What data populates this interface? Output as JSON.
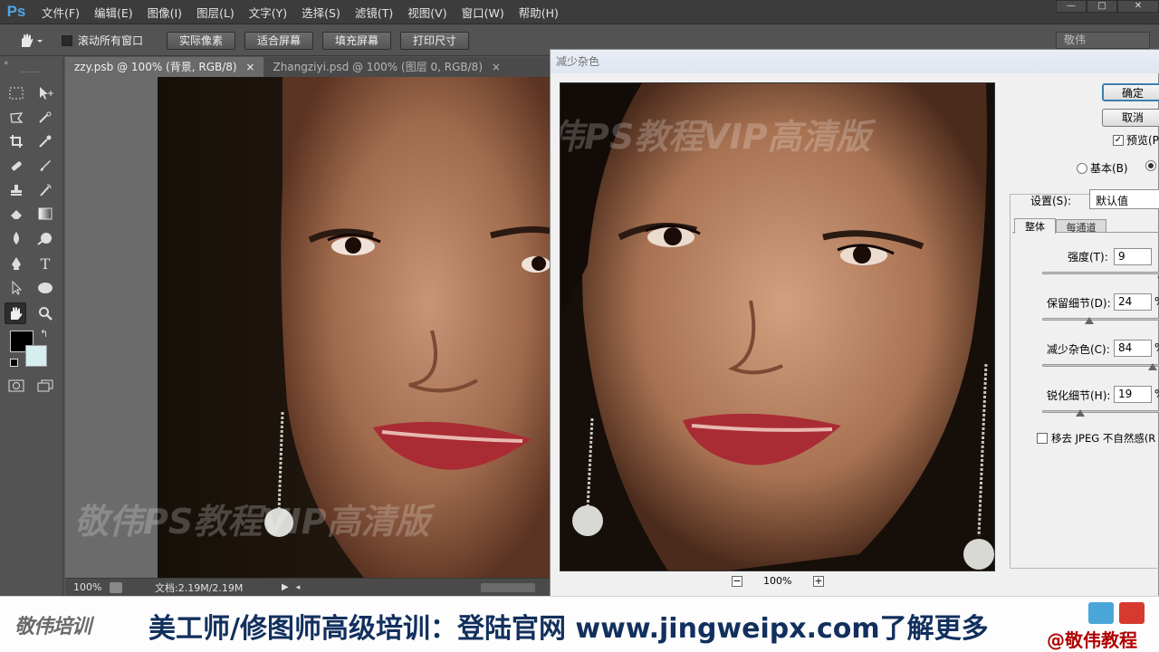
{
  "app": {
    "logo": "Ps",
    "brand_color": "#4ea5e6"
  },
  "menu": [
    "文件(F)",
    "编辑(E)",
    "图像(I)",
    "图层(L)",
    "文字(Y)",
    "选择(S)",
    "滤镜(T)",
    "视图(V)",
    "窗口(W)",
    "帮助(H)"
  ],
  "window_controls": {
    "minimize": "—",
    "restore": "□",
    "close": "✕"
  },
  "options": {
    "scroll_all_windows": "滚动所有窗口",
    "scroll_all_checked": false,
    "buttons": [
      "实际像素",
      "适合屏幕",
      "填充屏幕",
      "打印尺寸"
    ],
    "workspace": "敬伟"
  },
  "tabs": [
    {
      "label": "zzy.psb @ 100% (背景, RGB/8)",
      "active": true
    },
    {
      "label": "Zhangziyi.psd @ 100% (图层 0, RGB/8)",
      "active": false
    }
  ],
  "status": {
    "zoom": "100%",
    "doc_info": "文档:2.19M/2.19M"
  },
  "watermark": "敬伟PS教程VIP高清版",
  "dialog": {
    "title": "减少杂色",
    "ok": "确定",
    "cancel": "取消",
    "preview_label": "预览(P",
    "preview_checked": true,
    "basic_label": "基本(B)",
    "settings_label": "设置(S):",
    "settings_value": "默认值",
    "tab_overall": "整体",
    "tab_per_channel": "每通道",
    "strength_label": "强度(T):",
    "strength_value": "9",
    "preserve_label": "保留细节(D):",
    "preserve_value": "24",
    "reduce_label": "减少杂色(C):",
    "reduce_value": "84",
    "sharpen_label": "锐化细节(H):",
    "sharpen_value": "19",
    "percent": "%",
    "jpeg_label": "移去 JPEG 不自然感(R",
    "jpeg_checked": false,
    "zoom_value": "100%",
    "zoom_minus": "−",
    "zoom_plus": "+"
  },
  "banner": {
    "logo": "敬伟培训",
    "text": "美工师/修图师高级培训：登陆官网 www.jingweipx.com了解更多",
    "handle": "@敬伟教程"
  }
}
